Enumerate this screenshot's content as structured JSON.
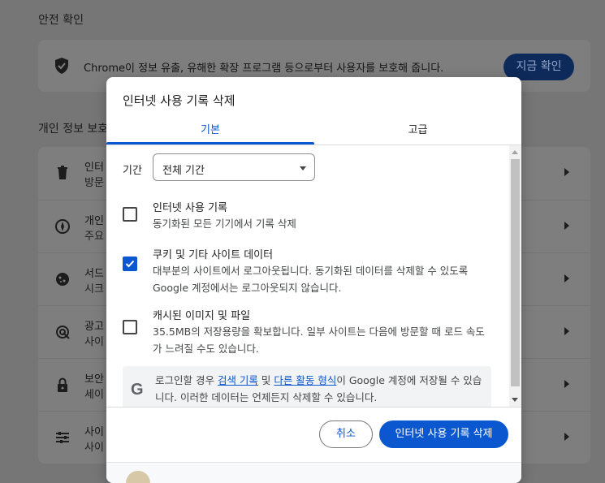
{
  "background": {
    "safety_heading": "안전 확인",
    "safety_text": "Chrome이 정보 유출, 유해한 확장 프로그램 등으로부터 사용자를 보호해 줍니다.",
    "safety_button": "지금 확인",
    "privacy_heading": "개인 정보 보호",
    "rows": [
      {
        "line1": "인터",
        "line2": "방문"
      },
      {
        "line1": "개인",
        "line2": "주요"
      },
      {
        "line1": "서드",
        "line2": "시크"
      },
      {
        "line1": "광고",
        "line2": "사이"
      },
      {
        "line1": "보안",
        "line2": "세이"
      },
      {
        "line1": "사이",
        "line2": "사이"
      }
    ]
  },
  "dialog": {
    "title": "인터넷 사용 기록 삭제",
    "tabs": [
      {
        "label": "기본",
        "selected": true
      },
      {
        "label": "고급",
        "selected": false
      }
    ],
    "period": {
      "label": "기간",
      "selected": "전체 기간"
    },
    "options": [
      {
        "title": "인터넷 사용 기록",
        "desc": "동기화된 모든 기기에서 기록 삭제",
        "checked": false
      },
      {
        "title": "쿠키 및 기타 사이트 데이터",
        "desc": "대부분의 사이트에서 로그아웃됩니다. 동기화된 데이터를 삭제할 수 있도록 Google 계정에서는 로그아웃되지 않습니다.",
        "checked": true
      },
      {
        "title": "캐시된 이미지 및 파일",
        "desc": "35.5MB의 저장용량을 확보합니다. 일부 사이트는 다음에 방문할 때 로드 속도가 느려질 수도 있습니다.",
        "checked": false
      }
    ],
    "google_notice": {
      "logo": "G",
      "before": "로그인할 경우 ",
      "link1": "검색 기록",
      "middle": " 및 ",
      "link2": "다른 활동 형식",
      "after": "이 Google 계정에 저장될 수 있습니다. 이러한 데이터는 언제든지 삭제할 수 있습니다."
    },
    "cancel_label": "취소",
    "delete_label": "인터넷 사용 기록 삭제"
  },
  "colors": {
    "accent": "#0b57d0",
    "scrim": "#767676"
  }
}
